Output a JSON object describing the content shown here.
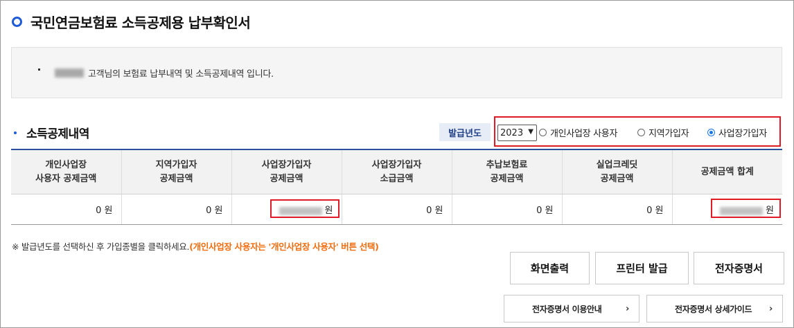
{
  "page": {
    "title": "국민연금보험료 소득공제용 납부확인서"
  },
  "notice": {
    "text": "고객님의 보험료 납부내역 및 소득공제내역 입니다."
  },
  "section": {
    "title": "소득공제내역"
  },
  "year_filter": {
    "label": "발급년도",
    "selected_year": "2023",
    "options": [
      {
        "label": "개인사업장 사용자",
        "selected": false
      },
      {
        "label": "지역가입자",
        "selected": false
      },
      {
        "label": "사업장가입자",
        "selected": true
      }
    ]
  },
  "table": {
    "headers": [
      "개인사업장\n사용자 공제금액",
      "지역가입자\n공제금액",
      "사업장가입자\n공제금액",
      "사업장가입자\n소급금액",
      "추납보험료\n공제금액",
      "실업크레딧\n공제금액",
      "공제금액 합계"
    ],
    "row": [
      "0 원",
      "0 원",
      "원",
      "0 원",
      "0 원",
      "0 원",
      "원"
    ]
  },
  "note": {
    "text": "※ 발급년도를 선택하신 후 가입종별을 클릭하세요.",
    "highlight": "(개인사업장 사용자는 '개인사업장 사용자' 버튼 선택)"
  },
  "buttons": {
    "screen_print": "화면출력",
    "printer_issue": "프린터 발급",
    "e_cert": "전자증명서",
    "e_cert_info": "전자증명서 이용안내",
    "e_cert_guide": "전자증명서 상세가이드"
  },
  "colors": {
    "accent": "#1f5bd7",
    "highlight_red": "#e01a22",
    "note_orange": "#f26c0d",
    "table_top": "#2a4f9c"
  }
}
